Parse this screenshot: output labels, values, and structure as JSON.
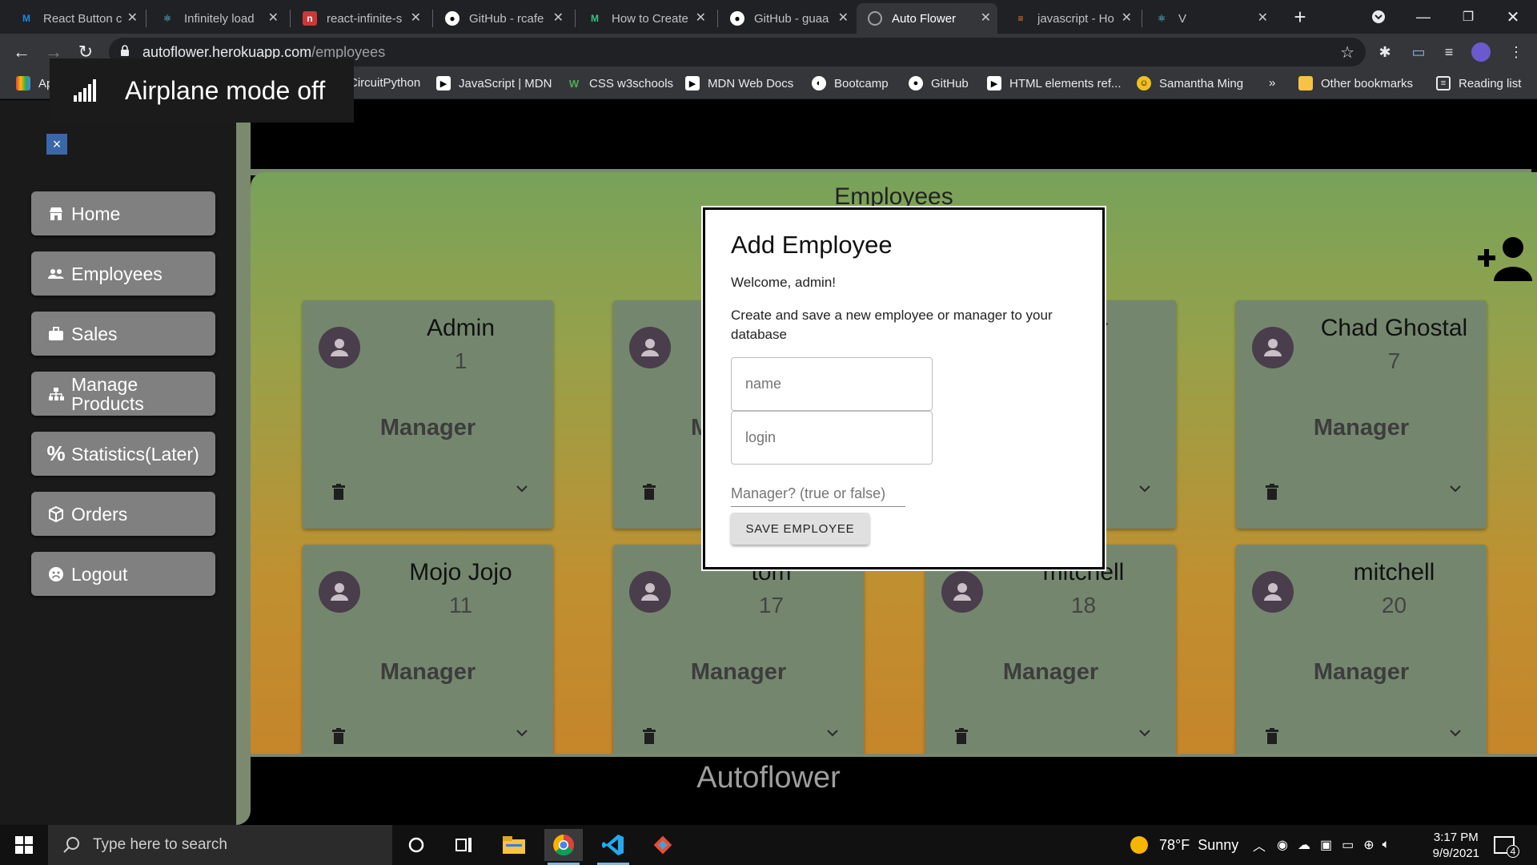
{
  "tabs": [
    {
      "title": "React Button c",
      "icon": "material-ui-icon",
      "color": "#1e88e5"
    },
    {
      "title": "Infinitely load",
      "icon": "react-icon",
      "color": "#61dafb"
    },
    {
      "title": "react-infinite-s",
      "icon": "npm-icon",
      "color": "#cb3837"
    },
    {
      "title": "GitHub - rcafe",
      "icon": "github-icon",
      "color": "#ffffff"
    },
    {
      "title": "How to Create",
      "icon": "medium-icon",
      "color": "#33c481"
    },
    {
      "title": "GitHub - guaa",
      "icon": "github-icon",
      "color": "#ffffff"
    },
    {
      "title": "Auto Flower",
      "icon": "globe-icon",
      "color": "#9aa0a6"
    },
    {
      "title": "javascript - Ho",
      "icon": "stackoverflow-icon",
      "color": "#f48024"
    },
    {
      "title": "V",
      "icon": "react-icon",
      "color": "#61dafb"
    }
  ],
  "address": {
    "host": "autoflower.herokuapp.com",
    "path": "/employees"
  },
  "bookmarks": [
    {
      "label": "Apps",
      "icon": "apps-grid-icon"
    },
    {
      "label": "CircuitPython",
      "icon": "bookmark-icon"
    },
    {
      "label": "JavaScript | MDN",
      "icon": "mdn-icon"
    },
    {
      "label": "CSS w3schools",
      "icon": "w3schools-icon"
    },
    {
      "label": "MDN Web Docs",
      "icon": "mdn-icon"
    },
    {
      "label": "Bootcamp",
      "icon": "bootcamp-icon"
    },
    {
      "label": "GitHub",
      "icon": "github-icon"
    },
    {
      "label": "HTML elements ref...",
      "icon": "mdn-icon"
    },
    {
      "label": "Samantha Ming",
      "icon": "samantha-icon"
    },
    {
      "label": "»",
      "icon": ""
    },
    {
      "label": "Other bookmarks",
      "icon": "folder-icon"
    },
    {
      "label": "Reading list",
      "icon": "reading-list-icon"
    }
  ],
  "toast": {
    "text": "Airplane mode off"
  },
  "sidebar": {
    "close_label": "×",
    "items": [
      {
        "label": "Home",
        "icon": "store-icon"
      },
      {
        "label": "Employees",
        "icon": "people-icon"
      },
      {
        "label": "Sales",
        "icon": "briefcase-icon"
      },
      {
        "label": "Manage\nProducts",
        "icon": "hierarchy-icon"
      },
      {
        "label": "Statistics(Later)",
        "icon": "percent-icon"
      },
      {
        "label": "Orders",
        "icon": "package-icon"
      },
      {
        "label": "Logout",
        "icon": "sad-face-icon"
      }
    ]
  },
  "main": {
    "title": "Employees"
  },
  "employees": [
    {
      "name": "Admin",
      "id": "1",
      "role": "Manager"
    },
    {
      "name": "",
      "id": "",
      "role": "M"
    },
    {
      "name": "r",
      "id": "",
      "role": ""
    },
    {
      "name": "Chad Ghostal",
      "id": "7",
      "role": "Manager"
    },
    {
      "name": "Mojo Jojo",
      "id": "11",
      "role": "Manager"
    },
    {
      "name": "tom",
      "id": "17",
      "role": "Manager"
    },
    {
      "name": "mitchell",
      "id": "18",
      "role": "Manager"
    },
    {
      "name": "mitchell",
      "id": "20",
      "role": "Manager"
    }
  ],
  "modal": {
    "title": "Add Employee",
    "welcome": "Welcome, admin!",
    "description": "Create and save a new employee or manager to your database",
    "name_placeholder": "name",
    "login_placeholder": "login",
    "manager_placeholder": "Manager? (true or false)",
    "save_label": "SAVE EMPLOYEE"
  },
  "footer": {
    "title": "Autoflower"
  },
  "taskbar": {
    "search_placeholder": "Type here to search",
    "weather": "78°F  Sunny",
    "time": "3:17 PM",
    "date": "9/9/2021",
    "notification_count": "4"
  }
}
